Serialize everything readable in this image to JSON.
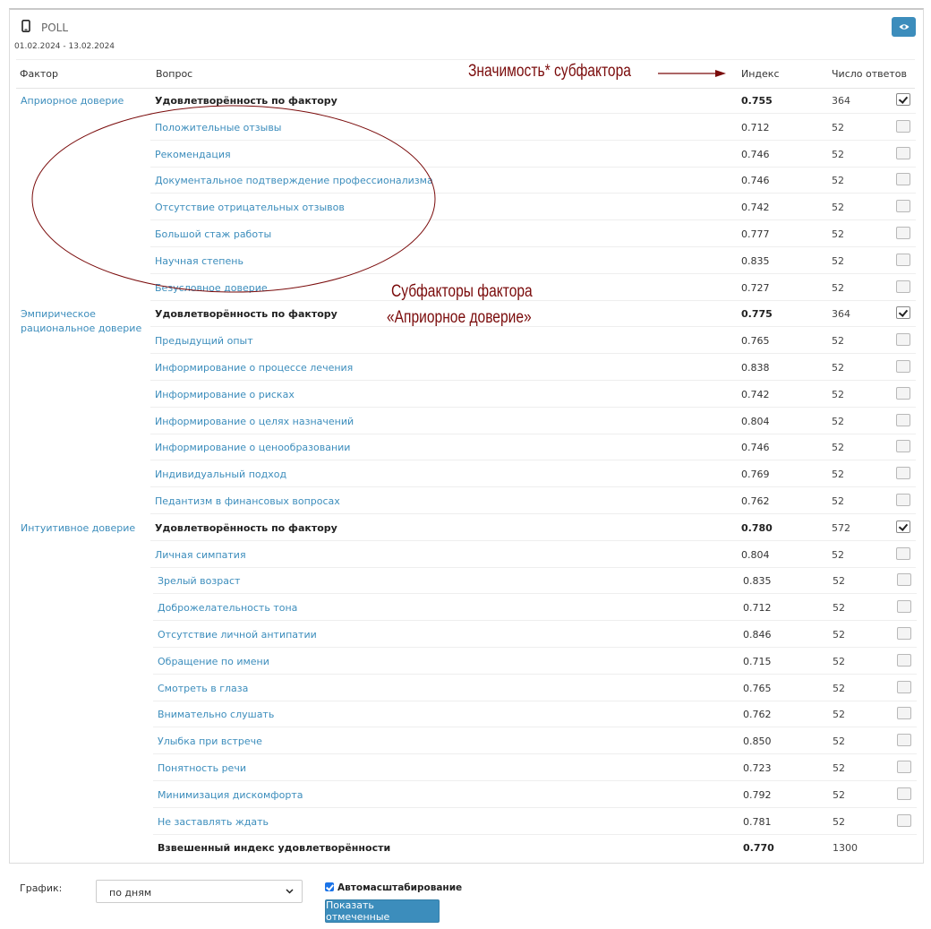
{
  "header": {
    "title": "POLL",
    "date_range": "01.02.2024 - 13.02.2024",
    "device_icon": "mobile-phone-icon",
    "view_icon": "eye-icon",
    "accent_color": "#3c8dbc"
  },
  "table": {
    "columns": {
      "factor": "Фактор",
      "question": "Вопрос",
      "index": "Индекс",
      "responses": "Число ответов"
    },
    "groups": [
      {
        "factor": "Априорное доверие",
        "rows": [
          {
            "question": "Удовлетворённость по фактору",
            "index": "0.755",
            "count": "364",
            "checked": true,
            "summary": true
          },
          {
            "question": "Положительные отзывы",
            "index": "0.712",
            "count": "52",
            "checked": false
          },
          {
            "question": "Рекомендация",
            "index": "0.746",
            "count": "52",
            "checked": false
          },
          {
            "question": "Документальное подтверждение профессионализма",
            "index": "0.746",
            "count": "52",
            "checked": false
          },
          {
            "question": "Отсутствие отрицательных отзывов",
            "index": "0.742",
            "count": "52",
            "checked": false
          },
          {
            "question": "Большой стаж работы",
            "index": "0.777",
            "count": "52",
            "checked": false
          },
          {
            "question": "Научная степень",
            "index": "0.835",
            "count": "52",
            "checked": false
          },
          {
            "question": "Безусловное доверие",
            "index": "0.727",
            "count": "52",
            "checked": false
          }
        ]
      },
      {
        "factor": "Эмпирическое рациональное доверие",
        "factor_lines": [
          "Эмпирическое",
          "рациональное доверие"
        ],
        "rows": [
          {
            "question": "Удовлетворённость по фактору",
            "index": "0.775",
            "count": "364",
            "checked": true,
            "summary": true
          },
          {
            "question": "Предыдущий опыт",
            "index": "0.765",
            "count": "52",
            "checked": false
          },
          {
            "question": "Информирование о процессе лечения",
            "index": "0.838",
            "count": "52",
            "checked": false
          },
          {
            "question": "Информирование о рисках",
            "index": "0.742",
            "count": "52",
            "checked": false
          },
          {
            "question": "Информирование о целях назначений",
            "index": "0.804",
            "count": "52",
            "checked": false
          },
          {
            "question": "Информирование о ценообразовании",
            "index": "0.746",
            "count": "52",
            "checked": false
          },
          {
            "question": "Индивидуальный подход",
            "index": "0.769",
            "count": "52",
            "checked": false
          },
          {
            "question": "Педантизм в финансовых вопросах",
            "index": "0.762",
            "count": "52",
            "checked": false
          }
        ]
      },
      {
        "factor": "Интуитивное доверие",
        "rows": [
          {
            "question": "Удовлетворённость по фактору",
            "index": "0.780",
            "count": "572",
            "checked": true,
            "summary": true
          },
          {
            "question": "Личная симпатия",
            "index": "0.804",
            "count": "52",
            "checked": false
          },
          {
            "question": "Зрелый возраст",
            "index": "0.835",
            "count": "52",
            "checked": false
          },
          {
            "question": "Доброжелательность тона",
            "index": "0.712",
            "count": "52",
            "checked": false
          },
          {
            "question": "Отсутствие личной антипатии",
            "index": "0.846",
            "count": "52",
            "checked": false
          },
          {
            "question": "Обращение по имени",
            "index": "0.715",
            "count": "52",
            "checked": false
          },
          {
            "question": "Смотреть в глаза",
            "index": "0.765",
            "count": "52",
            "checked": false
          },
          {
            "question": "Внимательно слушать",
            "index": "0.762",
            "count": "52",
            "checked": false
          },
          {
            "question": "Улыбка при встрече",
            "index": "0.850",
            "count": "52",
            "checked": false
          },
          {
            "question": "Понятность речи",
            "index": "0.723",
            "count": "52",
            "checked": false
          },
          {
            "question": "Минимизация дискомфорта",
            "index": "0.792",
            "count": "52",
            "checked": false
          },
          {
            "question": "Не заставлять ждать",
            "index": "0.781",
            "count": "52",
            "checked": false
          }
        ]
      }
    ],
    "total": {
      "label": "Взвешенный индекс удовлетворённости",
      "index": "0.770",
      "count": "1300"
    }
  },
  "annotations": {
    "significance": "Значимость* субфактора",
    "subfactors_line1": "Субфакторы фактора",
    "subfactors_line2": "«Априорное доверие»",
    "color": "#7a0b0b"
  },
  "footer": {
    "chart_label": "График:",
    "period_select": "по дням",
    "autoscale_label": "Автомасштабирование",
    "autoscale_checked": true,
    "show_button": "Показать отмеченные"
  }
}
